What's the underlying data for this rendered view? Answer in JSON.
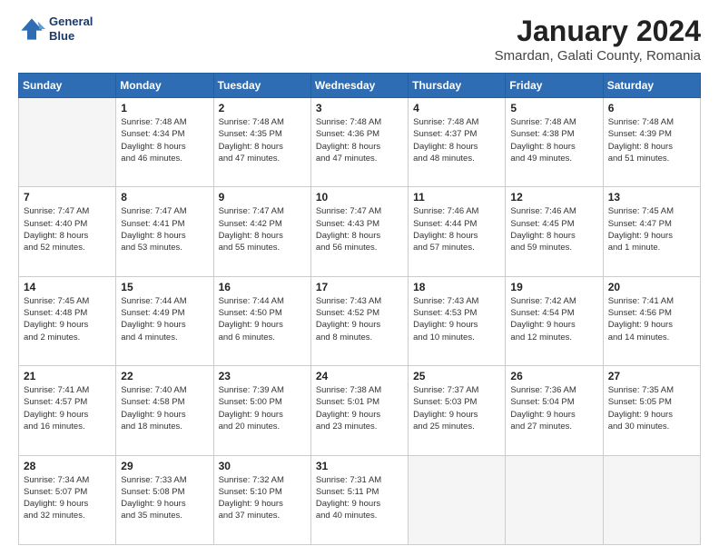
{
  "header": {
    "logo_line1": "General",
    "logo_line2": "Blue",
    "title": "January 2024",
    "subtitle": "Smardan, Galati County, Romania"
  },
  "weekdays": [
    "Sunday",
    "Monday",
    "Tuesday",
    "Wednesday",
    "Thursday",
    "Friday",
    "Saturday"
  ],
  "weeks": [
    [
      {
        "day": "",
        "lines": []
      },
      {
        "day": "1",
        "lines": [
          "Sunrise: 7:48 AM",
          "Sunset: 4:34 PM",
          "Daylight: 8 hours",
          "and 46 minutes."
        ]
      },
      {
        "day": "2",
        "lines": [
          "Sunrise: 7:48 AM",
          "Sunset: 4:35 PM",
          "Daylight: 8 hours",
          "and 47 minutes."
        ]
      },
      {
        "day": "3",
        "lines": [
          "Sunrise: 7:48 AM",
          "Sunset: 4:36 PM",
          "Daylight: 8 hours",
          "and 47 minutes."
        ]
      },
      {
        "day": "4",
        "lines": [
          "Sunrise: 7:48 AM",
          "Sunset: 4:37 PM",
          "Daylight: 8 hours",
          "and 48 minutes."
        ]
      },
      {
        "day": "5",
        "lines": [
          "Sunrise: 7:48 AM",
          "Sunset: 4:38 PM",
          "Daylight: 8 hours",
          "and 49 minutes."
        ]
      },
      {
        "day": "6",
        "lines": [
          "Sunrise: 7:48 AM",
          "Sunset: 4:39 PM",
          "Daylight: 8 hours",
          "and 51 minutes."
        ]
      }
    ],
    [
      {
        "day": "7",
        "lines": [
          "Sunrise: 7:47 AM",
          "Sunset: 4:40 PM",
          "Daylight: 8 hours",
          "and 52 minutes."
        ]
      },
      {
        "day": "8",
        "lines": [
          "Sunrise: 7:47 AM",
          "Sunset: 4:41 PM",
          "Daylight: 8 hours",
          "and 53 minutes."
        ]
      },
      {
        "day": "9",
        "lines": [
          "Sunrise: 7:47 AM",
          "Sunset: 4:42 PM",
          "Daylight: 8 hours",
          "and 55 minutes."
        ]
      },
      {
        "day": "10",
        "lines": [
          "Sunrise: 7:47 AM",
          "Sunset: 4:43 PM",
          "Daylight: 8 hours",
          "and 56 minutes."
        ]
      },
      {
        "day": "11",
        "lines": [
          "Sunrise: 7:46 AM",
          "Sunset: 4:44 PM",
          "Daylight: 8 hours",
          "and 57 minutes."
        ]
      },
      {
        "day": "12",
        "lines": [
          "Sunrise: 7:46 AM",
          "Sunset: 4:45 PM",
          "Daylight: 8 hours",
          "and 59 minutes."
        ]
      },
      {
        "day": "13",
        "lines": [
          "Sunrise: 7:45 AM",
          "Sunset: 4:47 PM",
          "Daylight: 9 hours",
          "and 1 minute."
        ]
      }
    ],
    [
      {
        "day": "14",
        "lines": [
          "Sunrise: 7:45 AM",
          "Sunset: 4:48 PM",
          "Daylight: 9 hours",
          "and 2 minutes."
        ]
      },
      {
        "day": "15",
        "lines": [
          "Sunrise: 7:44 AM",
          "Sunset: 4:49 PM",
          "Daylight: 9 hours",
          "and 4 minutes."
        ]
      },
      {
        "day": "16",
        "lines": [
          "Sunrise: 7:44 AM",
          "Sunset: 4:50 PM",
          "Daylight: 9 hours",
          "and 6 minutes."
        ]
      },
      {
        "day": "17",
        "lines": [
          "Sunrise: 7:43 AM",
          "Sunset: 4:52 PM",
          "Daylight: 9 hours",
          "and 8 minutes."
        ]
      },
      {
        "day": "18",
        "lines": [
          "Sunrise: 7:43 AM",
          "Sunset: 4:53 PM",
          "Daylight: 9 hours",
          "and 10 minutes."
        ]
      },
      {
        "day": "19",
        "lines": [
          "Sunrise: 7:42 AM",
          "Sunset: 4:54 PM",
          "Daylight: 9 hours",
          "and 12 minutes."
        ]
      },
      {
        "day": "20",
        "lines": [
          "Sunrise: 7:41 AM",
          "Sunset: 4:56 PM",
          "Daylight: 9 hours",
          "and 14 minutes."
        ]
      }
    ],
    [
      {
        "day": "21",
        "lines": [
          "Sunrise: 7:41 AM",
          "Sunset: 4:57 PM",
          "Daylight: 9 hours",
          "and 16 minutes."
        ]
      },
      {
        "day": "22",
        "lines": [
          "Sunrise: 7:40 AM",
          "Sunset: 4:58 PM",
          "Daylight: 9 hours",
          "and 18 minutes."
        ]
      },
      {
        "day": "23",
        "lines": [
          "Sunrise: 7:39 AM",
          "Sunset: 5:00 PM",
          "Daylight: 9 hours",
          "and 20 minutes."
        ]
      },
      {
        "day": "24",
        "lines": [
          "Sunrise: 7:38 AM",
          "Sunset: 5:01 PM",
          "Daylight: 9 hours",
          "and 23 minutes."
        ]
      },
      {
        "day": "25",
        "lines": [
          "Sunrise: 7:37 AM",
          "Sunset: 5:03 PM",
          "Daylight: 9 hours",
          "and 25 minutes."
        ]
      },
      {
        "day": "26",
        "lines": [
          "Sunrise: 7:36 AM",
          "Sunset: 5:04 PM",
          "Daylight: 9 hours",
          "and 27 minutes."
        ]
      },
      {
        "day": "27",
        "lines": [
          "Sunrise: 7:35 AM",
          "Sunset: 5:05 PM",
          "Daylight: 9 hours",
          "and 30 minutes."
        ]
      }
    ],
    [
      {
        "day": "28",
        "lines": [
          "Sunrise: 7:34 AM",
          "Sunset: 5:07 PM",
          "Daylight: 9 hours",
          "and 32 minutes."
        ]
      },
      {
        "day": "29",
        "lines": [
          "Sunrise: 7:33 AM",
          "Sunset: 5:08 PM",
          "Daylight: 9 hours",
          "and 35 minutes."
        ]
      },
      {
        "day": "30",
        "lines": [
          "Sunrise: 7:32 AM",
          "Sunset: 5:10 PM",
          "Daylight: 9 hours",
          "and 37 minutes."
        ]
      },
      {
        "day": "31",
        "lines": [
          "Sunrise: 7:31 AM",
          "Sunset: 5:11 PM",
          "Daylight: 9 hours",
          "and 40 minutes."
        ]
      },
      {
        "day": "",
        "lines": []
      },
      {
        "day": "",
        "lines": []
      },
      {
        "day": "",
        "lines": []
      }
    ]
  ]
}
